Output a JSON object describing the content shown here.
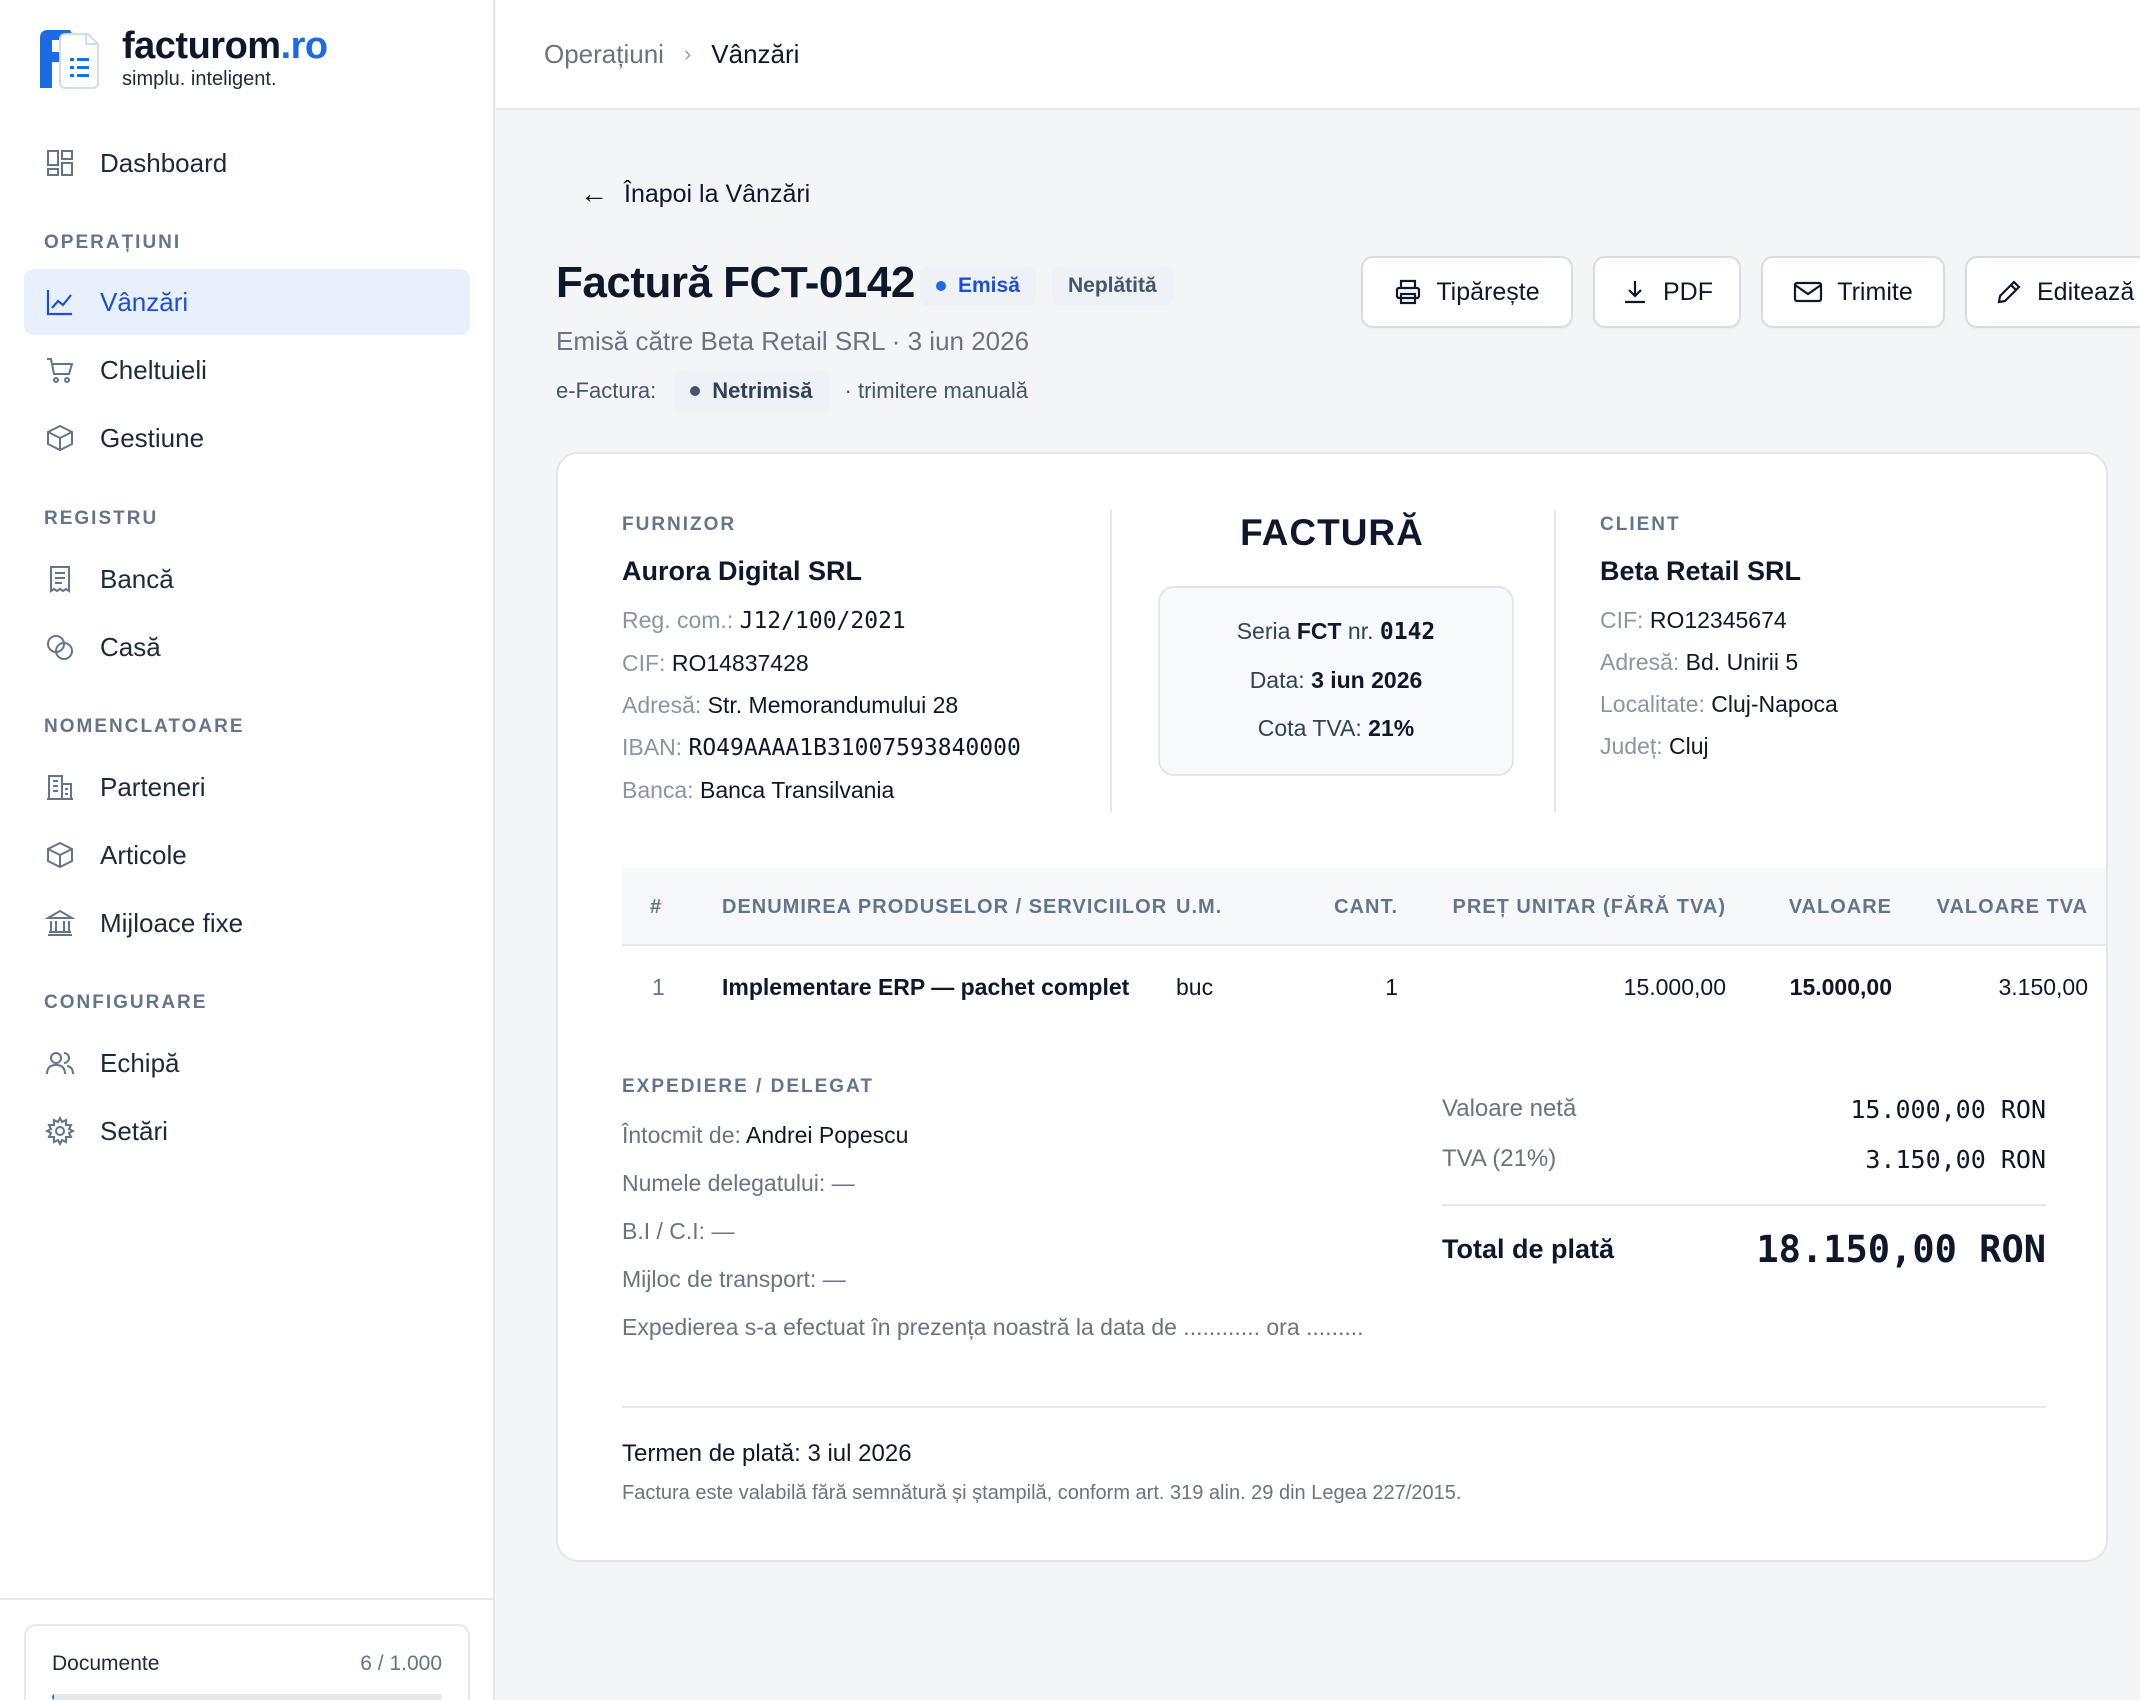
{
  "brand": {
    "name": "facturom",
    "tld": ".ro",
    "tagline": "simplu. inteligent."
  },
  "nav": {
    "dashboard": "Dashboard",
    "sections": {
      "operatiuni": "OPERAȚIUNI",
      "registru": "REGISTRU",
      "nomenclatoare": "NOMENCLATOARE",
      "configurare": "CONFIGURARE"
    },
    "items": {
      "vanzari": "Vânzări",
      "cheltuieli": "Cheltuieli",
      "gestiune": "Gestiune",
      "banca": "Bancă",
      "casa": "Casă",
      "parteneri": "Parteneri",
      "articole": "Articole",
      "mijloace": "Mijloace fixe",
      "echipa": "Echipă",
      "setari": "Setări"
    },
    "active": "vanzari"
  },
  "documents": {
    "label": "Documente",
    "count": "6 / 1.000",
    "used_fraction": 0.006
  },
  "breadcrumb": {
    "parent": "Operațiuni",
    "sep": "›",
    "current": "Vânzări"
  },
  "page": {
    "back": "Înapoi la Vânzări",
    "title": "Factură FCT-0142",
    "status": "Emisă",
    "payment_status": "Neplătită",
    "subtitle": "Emisă către Beta Retail SRL · 3 iun 2026",
    "efactura_label": "e-Factura:",
    "efactura_status": "Netrimisă",
    "efactura_note": "· trimitere manuală"
  },
  "actions": {
    "print": "Tipărește",
    "pdf": "PDF",
    "send": "Trimite",
    "edit": "Editează"
  },
  "invoice": {
    "supplier": {
      "label": "FURNIZOR",
      "name": "Aurora Digital SRL",
      "reg_k": "Reg. com.:",
      "reg_v": "J12/100/2021",
      "cif_k": "CIF:",
      "cif_v": "RO14837428",
      "addr_k": "Adresă:",
      "addr_v": "Str. Memorandumului 28",
      "iban_k": "IBAN:",
      "iban_v": "RO49AAAA1B31007593840000",
      "bank_k": "Banca:",
      "bank_v": "Banca Transilvania"
    },
    "doc_title": "FACTURĂ",
    "series_k": "Seria",
    "series_v": "FCT",
    "nr_k": "nr.",
    "nr_v": "0142",
    "date_k": "Data:",
    "date_v": "3 iun 2026",
    "vat_k": "Cota TVA:",
    "vat_v": "21%",
    "client": {
      "label": "CLIENT",
      "name": "Beta Retail SRL",
      "cif_k": "CIF:",
      "cif_v": "RO12345674",
      "addr_k": "Adresă:",
      "addr_v": "Bd. Unirii 5",
      "city_k": "Localitate:",
      "city_v": "Cluj-Napoca",
      "county_k": "Județ:",
      "county_v": "Cluj"
    },
    "table": {
      "headers": [
        "#",
        "DENUMIREA PRODUSELOR / SERVICIILOR",
        "U.M.",
        "CANT.",
        "PREȚ UNITAR (FĂRĂ TVA)",
        "VALOARE",
        "VALOARE TVA"
      ],
      "rows": [
        [
          "1",
          "Implementare ERP — pachet complet",
          "buc",
          "1",
          "15.000,00",
          "15.000,00",
          "3.150,00"
        ]
      ]
    },
    "shipping": {
      "label": "EXPEDIERE / DELEGAT",
      "made_k": "Întocmit de:",
      "made_v": "Andrei Popescu",
      "delegate": "Numele delegatului: —",
      "id": "B.I / C.I: —",
      "transport": "Mijloc de transport: —",
      "note": "Expedierea s-a efectuat în prezența noastră la data de ............ ora ........."
    },
    "totals": {
      "net_k": "Valoare netă",
      "net_v": "15.000,00 RON",
      "vat_k": "TVA (21%)",
      "vat_v": "3.150,00 RON",
      "total_k": "Total de plată",
      "total_v": "18.150,00 RON"
    },
    "footer": {
      "term_k": "Termen de plată:",
      "term_v": "3 iul 2026",
      "note": "Factura este valabilă fără semnătură și ștampilă, conform art. 319 alin. 29 din Legea 227/2015."
    }
  }
}
